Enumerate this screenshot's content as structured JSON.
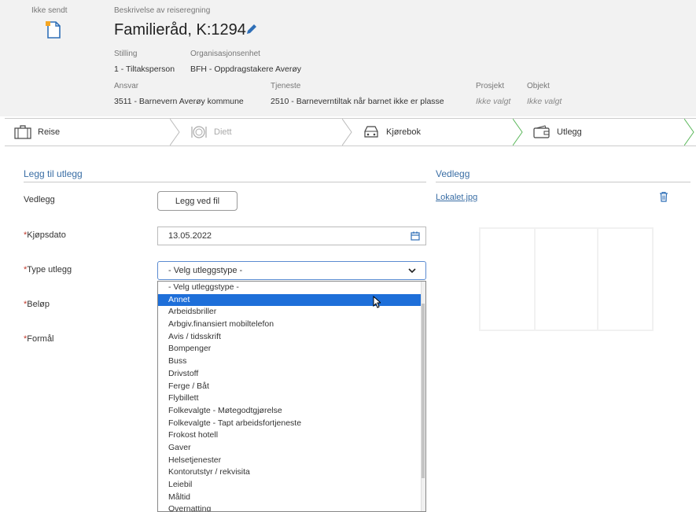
{
  "header": {
    "status": "Ikke sendt",
    "description_label": "Beskrivelse av reiseregning",
    "title": "Familieråd, K:1294",
    "fields": {
      "stilling": {
        "label": "Stilling",
        "value": "1 - Tiltaksperson"
      },
      "org": {
        "label": "Organisasjonsenhet",
        "value": "BFH - Oppdragstakere Averøy"
      },
      "ansvar": {
        "label": "Ansvar",
        "value": "3511 - Barnevern Averøy kommune"
      },
      "tjeneste": {
        "label": "Tjeneste",
        "value": "2510 - Barneverntiltak når barnet ikke er plasse"
      },
      "prosjekt": {
        "label": "Prosjekt",
        "value": "Ikke valgt"
      },
      "objekt": {
        "label": "Objekt",
        "value": "Ikke valgt"
      }
    }
  },
  "steps": [
    {
      "label": "Reise",
      "icon": "suitcase-icon"
    },
    {
      "label": "Diett",
      "icon": "plate-icon"
    },
    {
      "label": "Kjørebok",
      "icon": "car-icon"
    },
    {
      "label": "Utlegg",
      "icon": "wallet-icon"
    }
  ],
  "form": {
    "section_title": "Legg til utlegg",
    "vedlegg_label": "Vedlegg",
    "attach_button": "Legg ved fil",
    "date_label": "Kjøpsdato",
    "date_value": "13.05.2022",
    "type_label": "Type utlegg",
    "type_value": "- Velg utleggstype -",
    "amount_label": "Beløp",
    "purpose_label": "Formål",
    "required_mark": "*"
  },
  "dropdown": {
    "selected_index": 1,
    "options": [
      "- Velg utleggstype -",
      "Annet",
      "Arbeidsbriller",
      "Arbgiv.finansiert mobiltelefon",
      "Avis / tidsskrift",
      "Bompenger",
      "Buss",
      "Drivstoff",
      "Ferge / Båt",
      "Flybillett",
      "Folkevalgte - Møtegodtgjørelse",
      "Folkevalgte - Tapt arbeidsfortjeneste",
      "Frokost hotell",
      "Gaver",
      "Helsetjenester",
      "Kontorutstyr / rekvisita",
      "Leiebil",
      "Måltid",
      "Overnatting"
    ]
  },
  "attachments": {
    "section_title": "Vedlegg",
    "file_name": "Lokalet.jpg"
  },
  "colors": {
    "accent": "#3a6ea5",
    "selected": "#1e6fd9",
    "active_step_border": "#5cb85c"
  }
}
